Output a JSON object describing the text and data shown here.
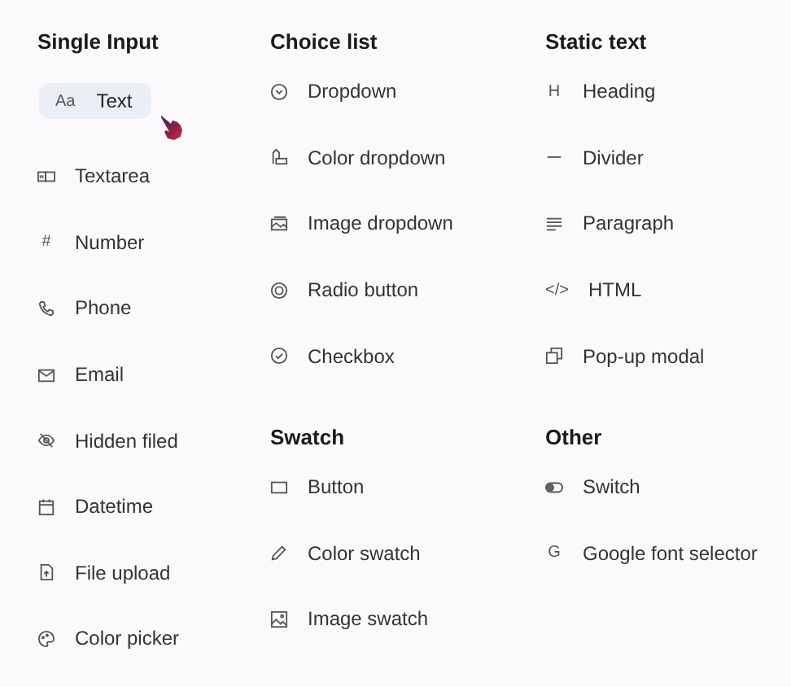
{
  "columns": [
    {
      "sections": [
        {
          "title": "Single Input",
          "items": [
            {
              "label": "Text",
              "kind": "text",
              "icon_label": "Aa",
              "selected": true
            },
            {
              "label": "Textarea",
              "kind": "textarea",
              "selected": false
            },
            {
              "label": "Number",
              "kind": "number",
              "icon_label": "#",
              "selected": false
            },
            {
              "label": "Phone",
              "kind": "phone",
              "selected": false
            },
            {
              "label": "Email",
              "kind": "email",
              "selected": false
            },
            {
              "label": "Hidden filed",
              "kind": "hidden",
              "selected": false
            },
            {
              "label": "Datetime",
              "kind": "datetime",
              "selected": false
            },
            {
              "label": "File upload",
              "kind": "file_upload",
              "selected": false
            },
            {
              "label": "Color picker",
              "kind": "color_picker",
              "selected": false
            }
          ]
        }
      ]
    },
    {
      "sections": [
        {
          "title": "Choice list",
          "items": [
            {
              "label": "Dropdown",
              "kind": "dropdown",
              "selected": false
            },
            {
              "label": "Color dropdown",
              "kind": "color_dropdown",
              "selected": false
            },
            {
              "label": "Image dropdown",
              "kind": "image_dropdown",
              "selected": false
            },
            {
              "label": "Radio button",
              "kind": "radio",
              "selected": false
            },
            {
              "label": "Checkbox",
              "kind": "checkbox",
              "selected": false
            }
          ]
        },
        {
          "title": "Swatch",
          "items": [
            {
              "label": "Button",
              "kind": "button",
              "selected": false
            },
            {
              "label": "Color swatch",
              "kind": "color_swatch",
              "selected": false
            },
            {
              "label": "Image swatch",
              "kind": "image_swatch",
              "selected": false
            }
          ]
        }
      ]
    },
    {
      "sections": [
        {
          "title": "Static text",
          "items": [
            {
              "label": "Heading",
              "kind": "heading",
              "icon_label": "H",
              "selected": false
            },
            {
              "label": "Divider",
              "kind": "divider",
              "selected": false
            },
            {
              "label": "Paragraph",
              "kind": "paragraph",
              "selected": false
            },
            {
              "label": "HTML",
              "kind": "html",
              "icon_label": "</>",
              "selected": false
            },
            {
              "label": "Pop-up modal",
              "kind": "popup",
              "selected": false
            }
          ]
        },
        {
          "title": "Other",
          "items": [
            {
              "label": "Switch",
              "kind": "switch",
              "selected": false
            },
            {
              "label": "Google font selector",
              "kind": "google_font",
              "icon_label": "G",
              "selected": false
            }
          ]
        }
      ]
    }
  ]
}
